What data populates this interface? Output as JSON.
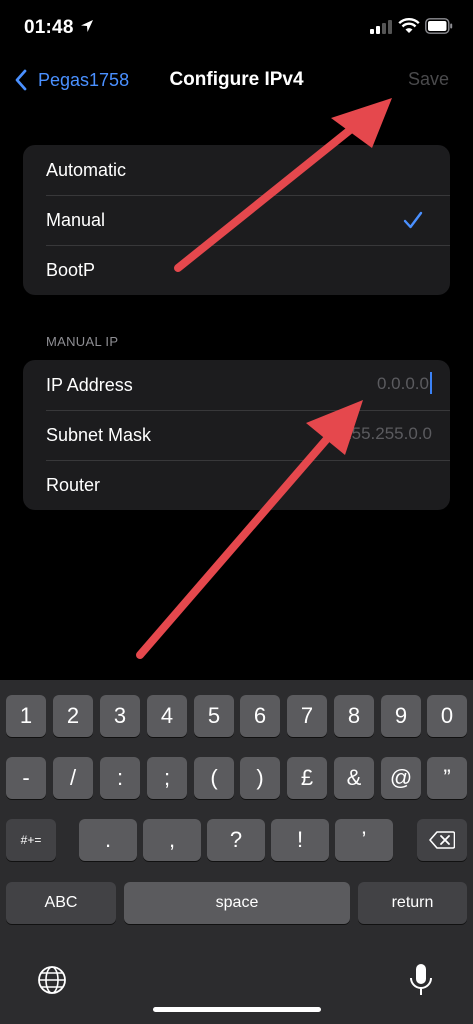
{
  "status_bar": {
    "time": "01:48"
  },
  "nav": {
    "back_label": "Pegas1758",
    "title": "Configure IPv4",
    "save_label": "Save"
  },
  "config_options": [
    {
      "label": "Automatic",
      "selected": false
    },
    {
      "label": "Manual",
      "selected": true
    },
    {
      "label": "BootP",
      "selected": false
    }
  ],
  "manual_ip": {
    "section_label": "MANUAL IP",
    "fields": [
      {
        "label": "IP Address",
        "placeholder": "0.0.0.0"
      },
      {
        "label": "Subnet Mask",
        "placeholder": "255.255.0.0"
      },
      {
        "label": "Router",
        "placeholder": ""
      }
    ]
  },
  "keyboard": {
    "row1": [
      "1",
      "2",
      "3",
      "4",
      "5",
      "6",
      "7",
      "8",
      "9",
      "0"
    ],
    "row2": [
      "-",
      "/",
      ":",
      ";",
      "(",
      ")",
      "£",
      "&",
      "@",
      "”"
    ],
    "row3": {
      "shift_label": "#+=",
      "keys": [
        ".",
        ",",
        "?",
        "!",
        "’"
      ]
    },
    "row4": {
      "abc_label": "ABC",
      "space_label": "space",
      "return_label": "return"
    }
  },
  "colors": {
    "accent": "#4a90ff",
    "annotation_arrow": "#e5484d"
  }
}
